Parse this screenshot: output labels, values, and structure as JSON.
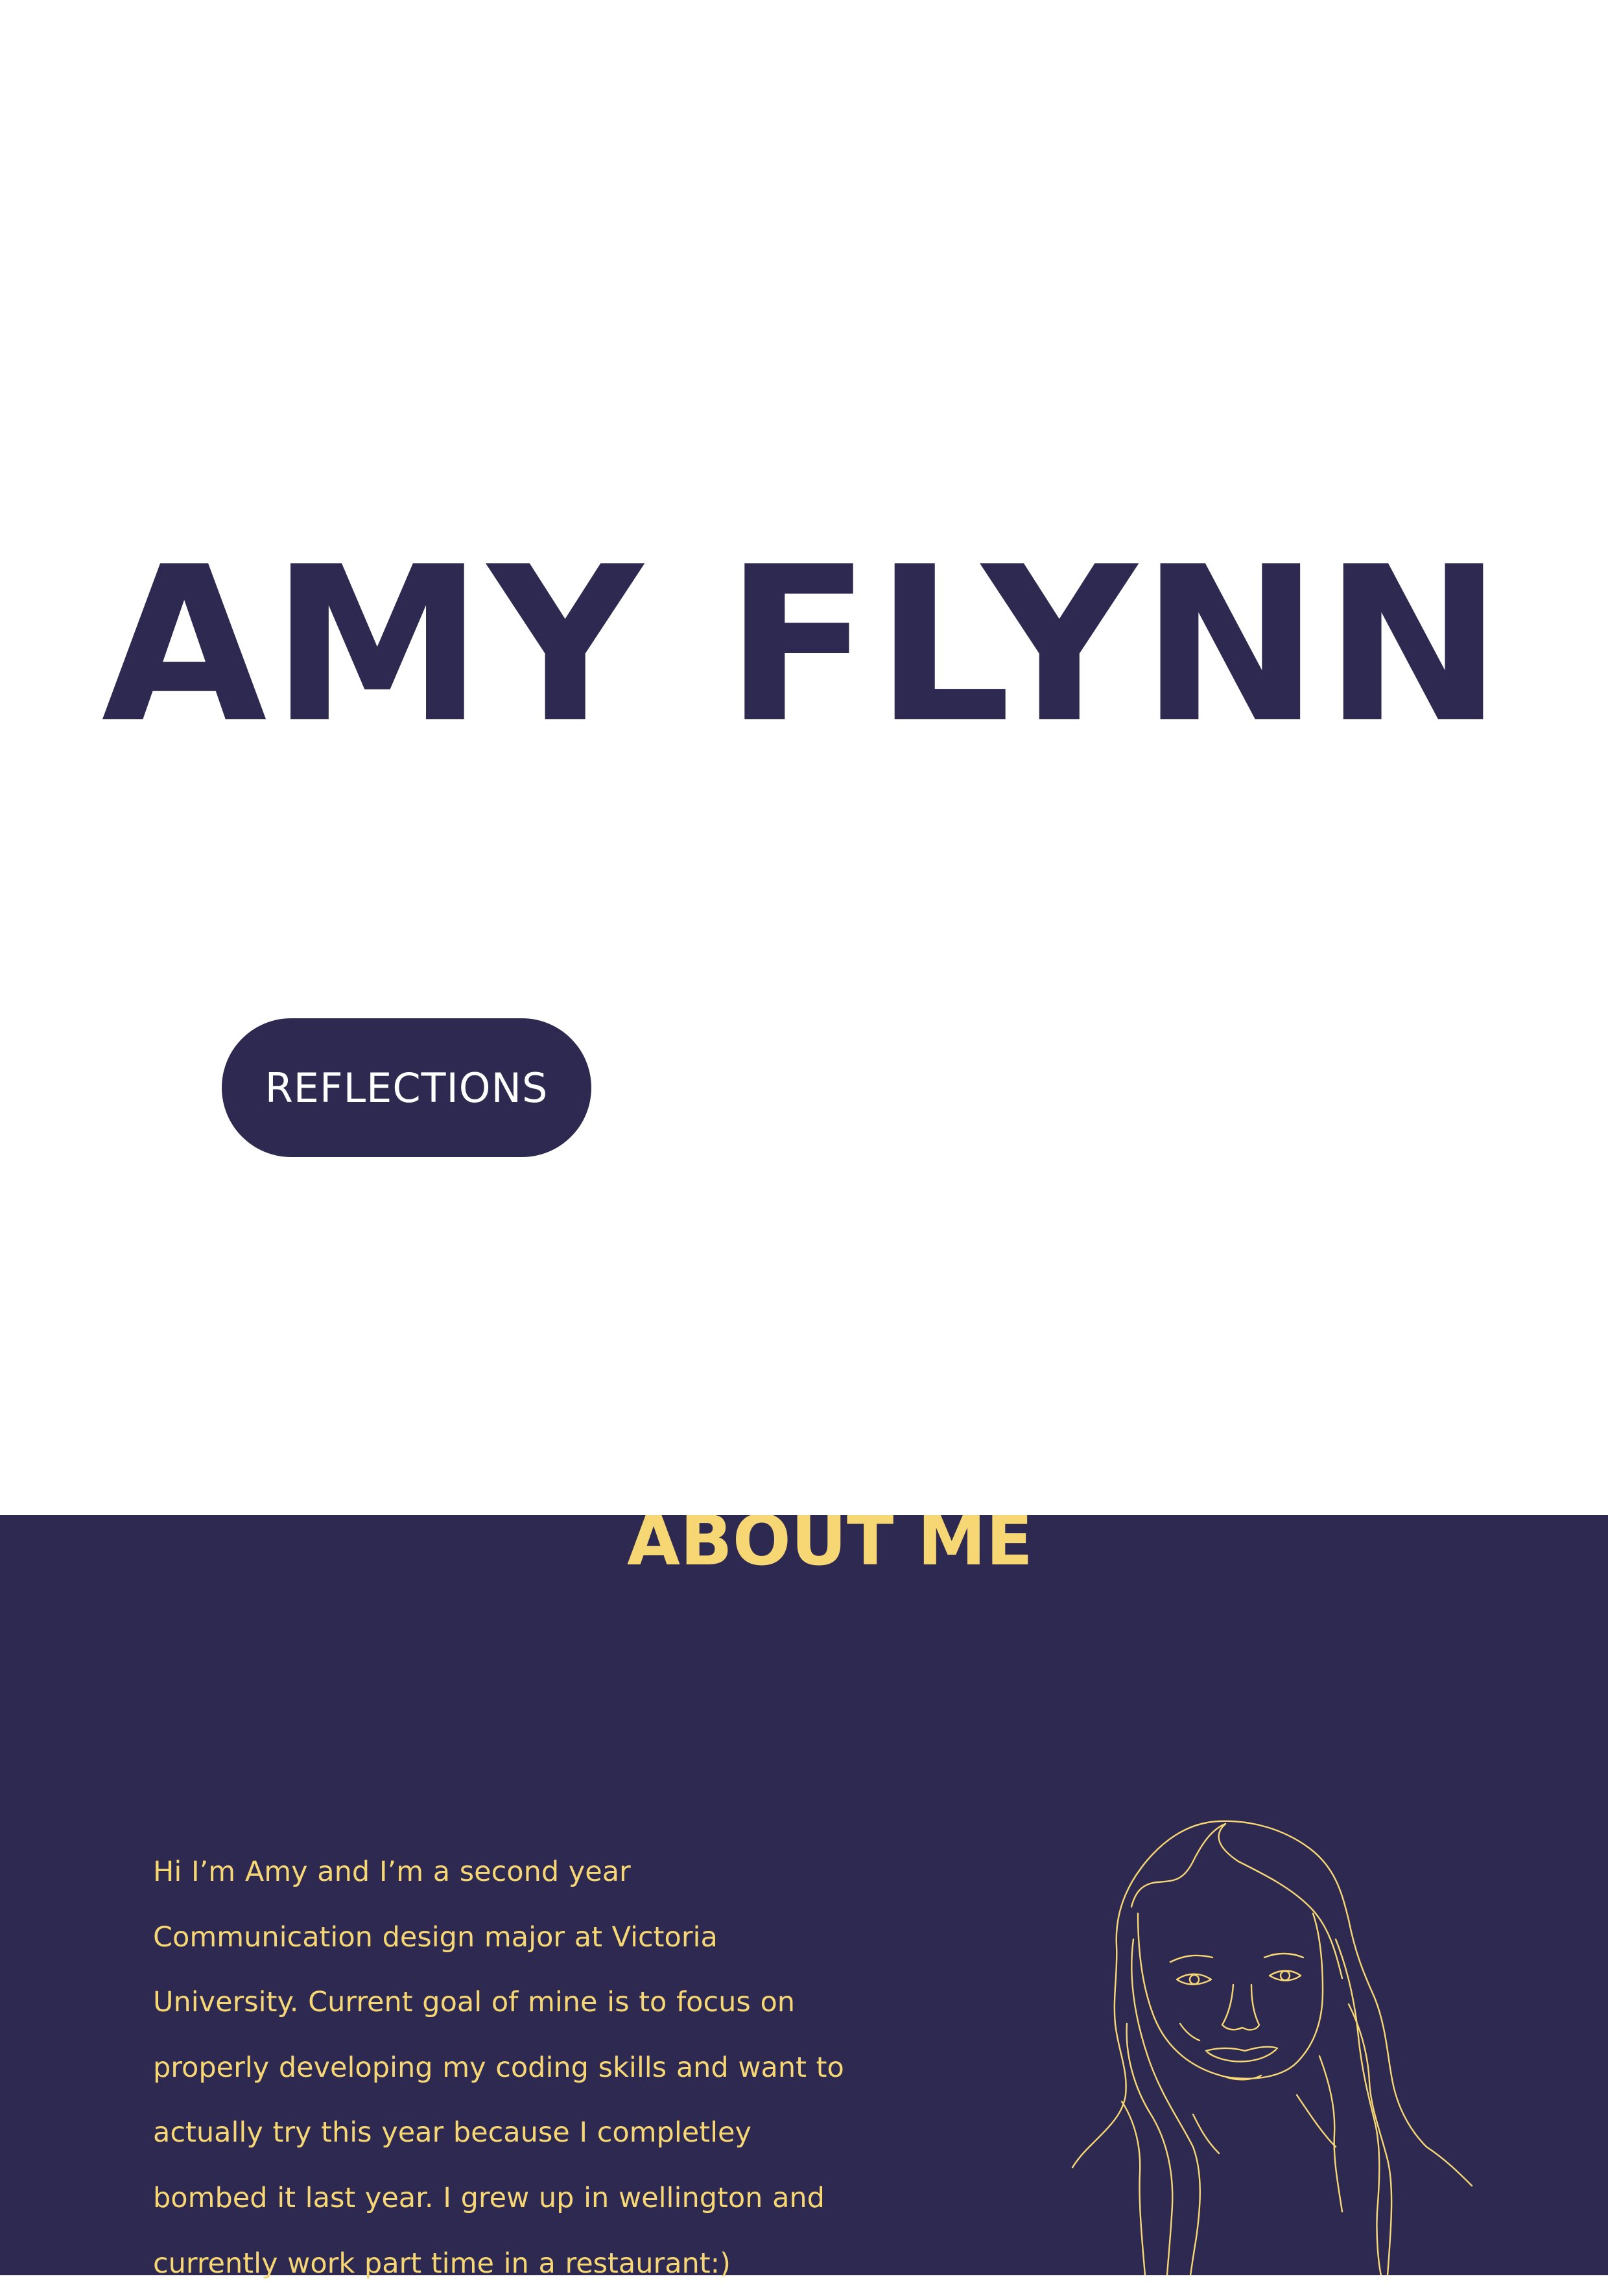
{
  "hero": {
    "name": "AMY FLYNN",
    "button_label": "REFLECTIONS"
  },
  "about": {
    "title": "ABOUT ME",
    "body": "Hi I’m Amy and I’m a second year Communication design major at Victoria University. Current goal of mine is to focus on properly developing my coding skills and want to actually try this year because I completley bombed it last year. I grew up in wellington and currently work part time in a restaurant:)",
    "portrait_icon": "line-drawing-portrait"
  },
  "colors": {
    "navy": "#2e2950",
    "yellow": "#f6d774",
    "white": "#ffffff"
  }
}
